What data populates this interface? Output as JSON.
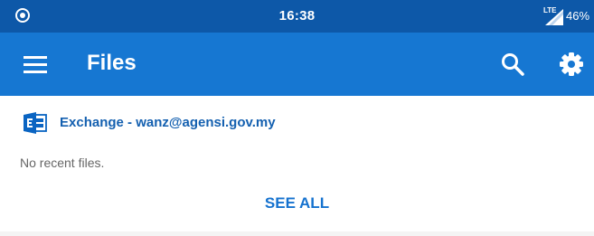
{
  "status_bar": {
    "time": "16:38",
    "network": "LTE",
    "battery": "46%",
    "icons": [
      "record-icon",
      "signal-icon"
    ]
  },
  "app_bar": {
    "title": "Files",
    "icons": [
      "menu-icon",
      "search-icon",
      "settings-icon"
    ]
  },
  "account": {
    "label": "Exchange - wanz@agensi.gov.my",
    "icon": "exchange-icon"
  },
  "recent": {
    "empty_text": "No recent files.",
    "see_all": "SEE ALL"
  },
  "colors": {
    "status_bar": "#0d58a8",
    "app_bar": "#1677d2",
    "accent_text": "#1572cf",
    "background": "#f4f4f4"
  }
}
